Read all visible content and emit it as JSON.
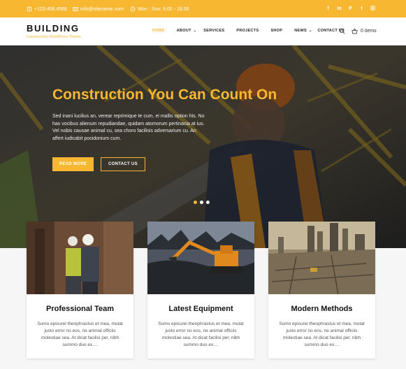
{
  "topbar": {
    "phone": "+123.456.4568",
    "email": "info@sitename.com",
    "hours": "Mon - Sun: 9.00 - 18.00",
    "social": [
      "f",
      "in",
      "P",
      "t",
      "ig"
    ]
  },
  "header": {
    "logo": "BUILDING",
    "tagline": "Construction WordPress Theme",
    "nav": [
      "HOME",
      "ABOUT",
      "SERVICES",
      "PROJECTS",
      "SHOP",
      "NEWS",
      "CONTACT US"
    ],
    "cart_label": "0 items"
  },
  "hero": {
    "title": "Construction You Can Count On",
    "text": "Sed inani lucilius an, verear reprimique te cum, ei mallis option his. No has vocibus alienum repudiandae, quidam atomorum pertinacia at ius. Vel nobis causae animal cu, sea choro facilisis adversarium cu. An affert iudicabit posidonium cum.",
    "read_more": "READ MORE",
    "contact_us": "CONTACT US",
    "slides": 3,
    "active_slide": 1
  },
  "features": [
    {
      "title": "Professional Team",
      "text": "Sumo epicurei theophrastus et mea, mutat justo error no eos, ne animal officiis molestiae sea. At dicat facilisi per, nibh summo duo ex...."
    },
    {
      "title": "Latest Equipment",
      "text": "Sumo epicurei theophrastus et mea, mutat justo error no eos, ne animal officiis molestiae sea. At dicat facilisi per, nibh summo duo ex...."
    },
    {
      "title": "Modern Methods",
      "text": "Sumo epicurei theophrastus et mea, mutat justo error no eos, ne animal officiis molestiae sea. At dicat facilisi per, nibh summo duo ex...."
    }
  ],
  "colors": {
    "accent": "#f7b731",
    "dark": "#111111"
  }
}
